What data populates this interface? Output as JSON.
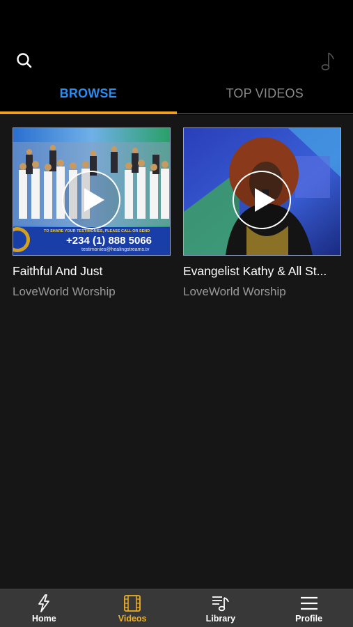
{
  "header": {
    "search_icon": "search-icon",
    "music_icon": "music-note-icon"
  },
  "tabs": [
    {
      "label": "BROWSE",
      "active": true
    },
    {
      "label": "TOP VIDEOS",
      "active": false
    }
  ],
  "videos": [
    {
      "title": "Faithful And Just",
      "channel": "LoveWorld Worship",
      "thumb_text": {
        "line1": "TO SHARE YOUR TESTIMONIES, PLEASE CALL OR SEND",
        "phone": "+234 (1) 888 5066",
        "email": "testimonies@healingstreams.tv"
      }
    },
    {
      "title": "Evangelist Kathy & All St...",
      "channel": "LoveWorld Worship"
    }
  ],
  "bottom_nav": [
    {
      "label": "Home",
      "icon": "lightning-icon",
      "active": false
    },
    {
      "label": "Videos",
      "icon": "film-icon",
      "active": true
    },
    {
      "label": "Library",
      "icon": "playlist-icon",
      "active": false
    },
    {
      "label": "Profile",
      "icon": "menu-icon",
      "active": false
    }
  ],
  "colors": {
    "accent_blue": "#2a8cf0",
    "accent_orange": "#f0a020",
    "active_nav": "#f0b020",
    "background": "#161616"
  }
}
